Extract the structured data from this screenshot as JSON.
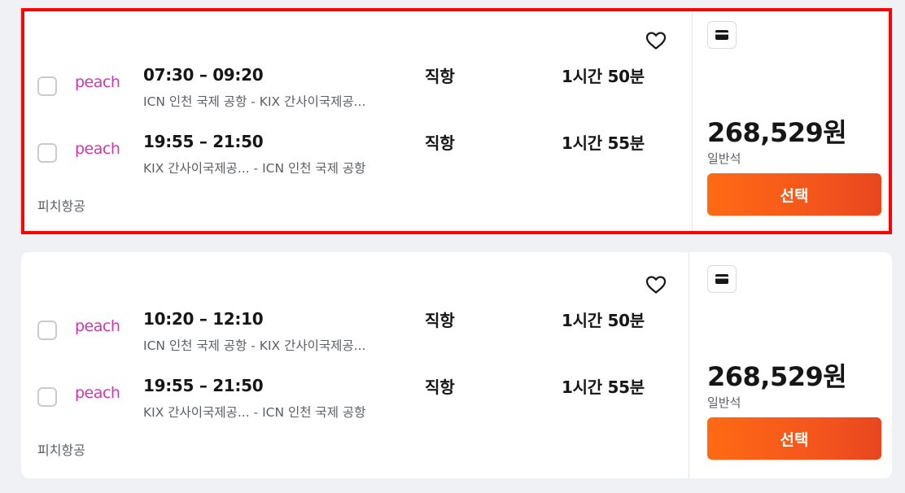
{
  "colors": {
    "accent": "#ff6a13",
    "highlight_border": "#ff0000",
    "airline_logo": "#d533b1"
  },
  "results": [
    {
      "legs": [
        {
          "airline_logo": "peach",
          "time": "07:30 – 09:20",
          "route": "ICN 인천 국제 공항 - KIX 간사이국제공...",
          "stops": "직항",
          "duration": "1시간 50분"
        },
        {
          "airline_logo": "peach",
          "time": "19:55 – 21:50",
          "route": "KIX 간사이국제공... - ICN 인천 국제 공항",
          "stops": "직항",
          "duration": "1시간 55분"
        }
      ],
      "airline_name": "피치항공",
      "price": "268,529원",
      "cabin": "일반석",
      "select_label": "선택",
      "fare_icon": "card-icon",
      "favorite_icon": "heart-outline-icon"
    },
    {
      "legs": [
        {
          "airline_logo": "peach",
          "time": "10:20 – 12:10",
          "route": "ICN 인천 국제 공항 - KIX 간사이국제공...",
          "stops": "직항",
          "duration": "1시간 50분"
        },
        {
          "airline_logo": "peach",
          "time": "19:55 – 21:50",
          "route": "KIX 간사이국제공... - ICN 인천 국제 공항",
          "stops": "직항",
          "duration": "1시간 55분"
        }
      ],
      "airline_name": "피치항공",
      "price": "268,529원",
      "cabin": "일반석",
      "select_label": "선택",
      "fare_icon": "card-icon",
      "favorite_icon": "heart-outline-icon"
    }
  ]
}
